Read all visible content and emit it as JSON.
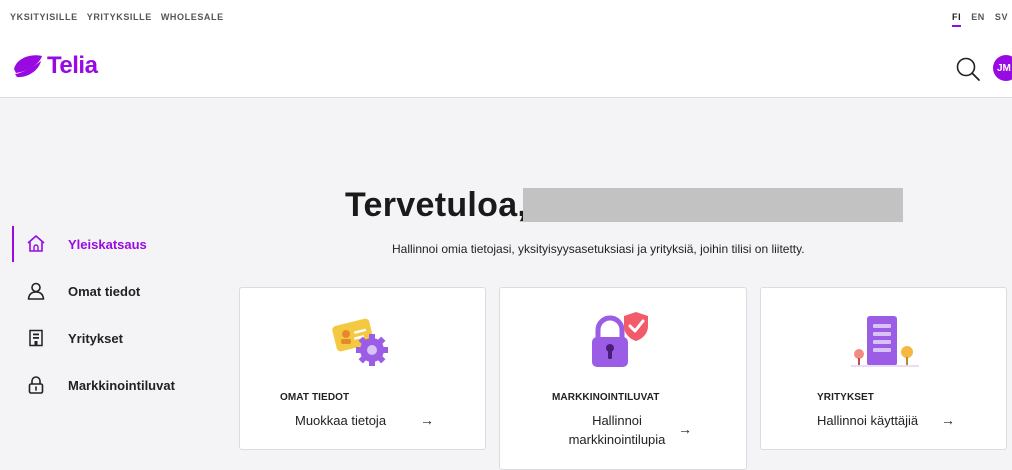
{
  "colors": {
    "brand": "#990ae3",
    "background": "#f4f4f6",
    "redacted": "#c2c2c2"
  },
  "topbar": {
    "segments": [
      "YKSITYISILLE",
      "YRITYKSILLE",
      "WHOLESALE"
    ],
    "languages": [
      "FI",
      "EN",
      "SV"
    ],
    "active_language": "FI",
    "logo_text": "Telia",
    "search_icon": "search-icon",
    "avatar_initials": "JM"
  },
  "main": {
    "welcome": "Tervetuloa,",
    "subtitle": "Hallinnoi omia tietojasi, yksityisyysasetuksiasi ja yrityksiä, joihin tilisi on liitetty."
  },
  "sidebar": {
    "items": [
      {
        "label": "Yleiskatsaus",
        "icon": "home-icon",
        "active": true
      },
      {
        "label": "Omat tiedot",
        "icon": "user-icon",
        "active": false
      },
      {
        "label": "Yritykset",
        "icon": "building-icon",
        "active": false
      },
      {
        "label": "Markkinointiluvat",
        "icon": "lock-icon",
        "active": false
      }
    ]
  },
  "cards": [
    {
      "category": "OMAT TIEDOT",
      "action": "Muokkaa tietoja",
      "icon": "id-card-gear-icon",
      "arrow": "→"
    },
    {
      "category": "MARKKINOINTILUVAT",
      "action": "Hallinnoi markkinointilupia",
      "action_line1": "Hallinnoi",
      "action_line2": "markkinointilupia",
      "icon": "padlock-shield-icon",
      "arrow": "→"
    },
    {
      "category": "YRITYKSET",
      "action": "Hallinnoi käyttäjiä",
      "icon": "office-building-icon",
      "arrow": "→"
    }
  ]
}
